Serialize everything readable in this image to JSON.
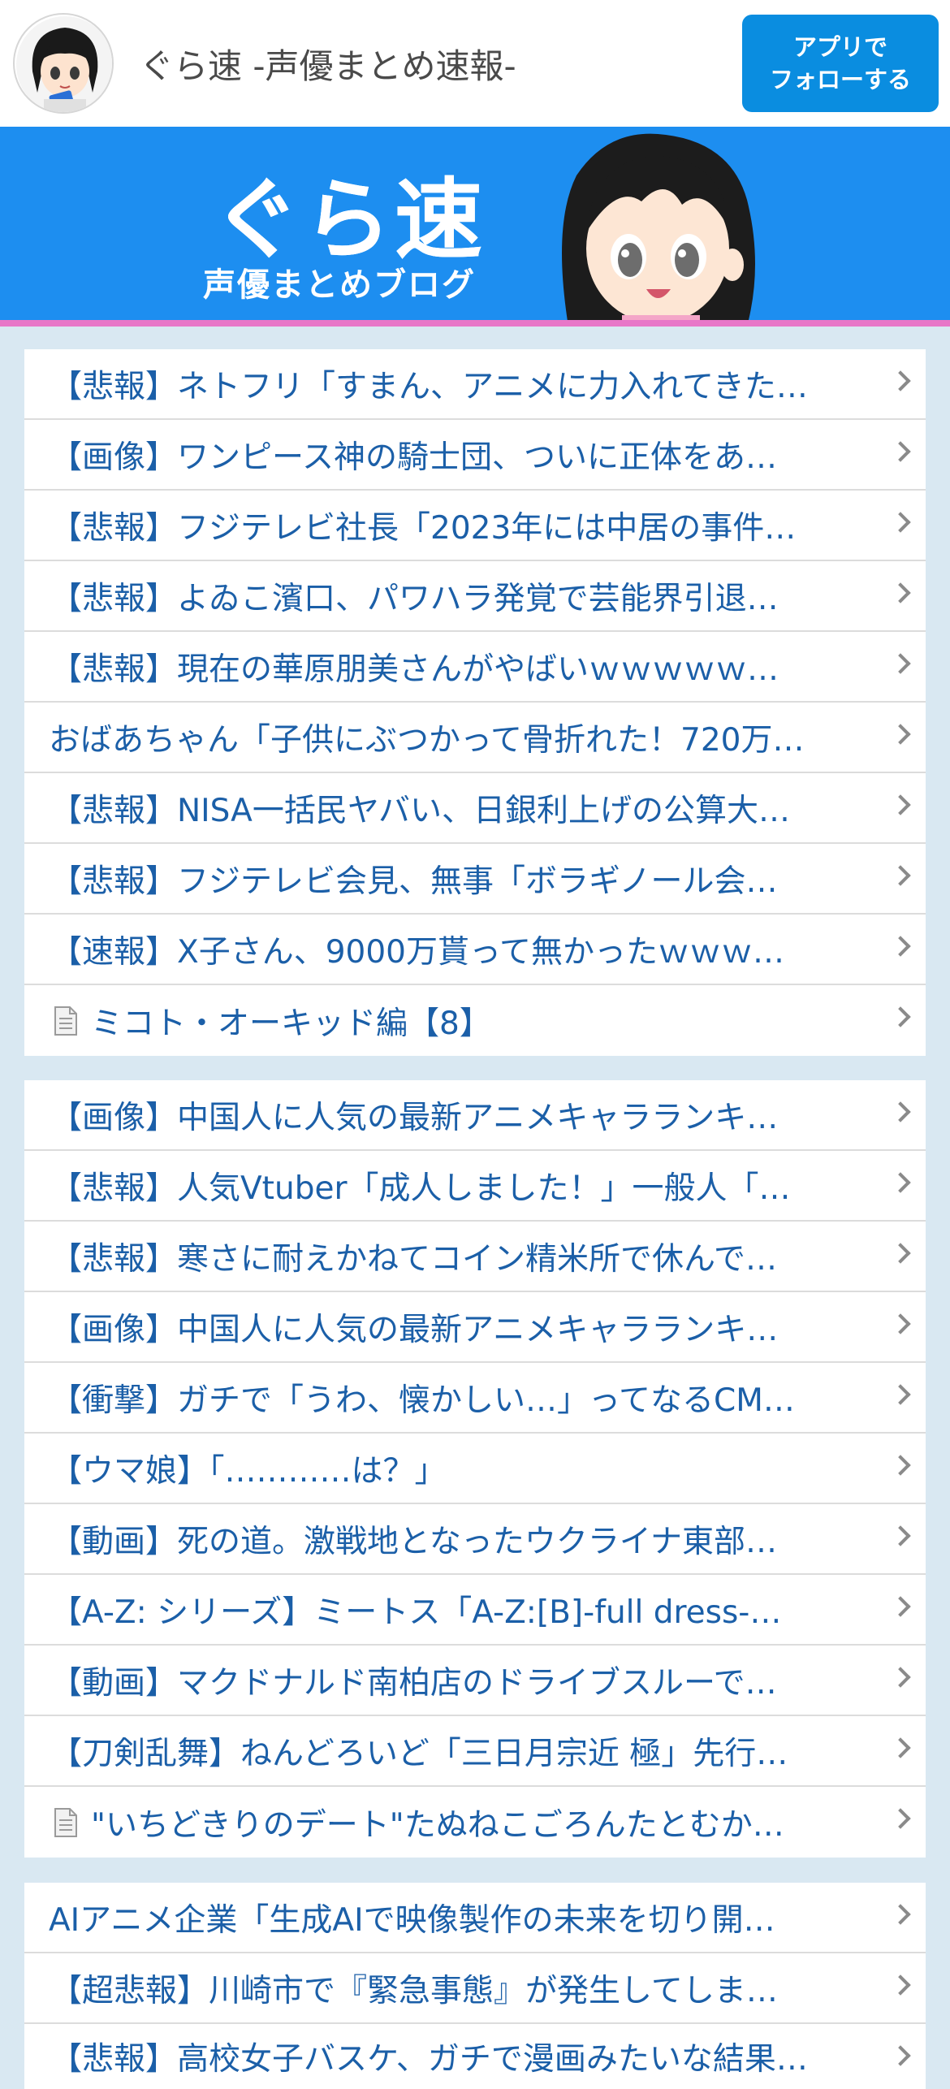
{
  "header": {
    "site_title": "ぐら速  -声優まとめ速報-",
    "follow_button_line1": "アプリで",
    "follow_button_line2": "フォローする"
  },
  "banner": {
    "logo_text": "ぐら速",
    "subtitle": "声優まとめブログ"
  },
  "lists": [
    {
      "items": [
        {
          "text": "【悲報】ネトフリ「すまん、アニメに力入れてきた…",
          "icon": null
        },
        {
          "text": "【画像】ワンピース神の騎士団、ついに正体をあ…",
          "icon": null
        },
        {
          "text": "【悲報】フジテレビ社長「2023年には中居の事件…",
          "icon": null
        },
        {
          "text": "【悲報】よゐこ濱口、パワハラ発覚で芸能界引退…",
          "icon": null
        },
        {
          "text": "【悲報】現在の華原朋美さんがやばいｗｗｗｗｗ…",
          "icon": null
        },
        {
          "text": "おばあちゃん「子供にぶつかって骨折れた！720万…",
          "icon": null
        },
        {
          "text": "【悲報】NISA一括民ヤバい、日銀利上げの公算大…",
          "icon": null
        },
        {
          "text": "【悲報】フジテレビ会見、無事「ボラギノール会…",
          "icon": null
        },
        {
          "text": "【速報】X子さん、9000万貰って無かったｗｗｗ…",
          "icon": null
        },
        {
          "text": "ミコト・オーキッド編【8】",
          "icon": "document-icon"
        }
      ]
    },
    {
      "items": [
        {
          "text": "【画像】中国人に人気の最新アニメキャラランキ…",
          "icon": null
        },
        {
          "text": "【悲報】人気Vtuber「成人しました！」一般人「…",
          "icon": null
        },
        {
          "text": "【悲報】寒さに耐えかねてコイン精米所で休んで…",
          "icon": null
        },
        {
          "text": "【画像】中国人に人気の最新アニメキャラランキ…",
          "icon": null
        },
        {
          "text": "【衝撃】ガチで「うわ、懐かしい…」ってなるCM…",
          "icon": null
        },
        {
          "text": "【ウマ娘】「…………は？」",
          "icon": null
        },
        {
          "text": "【動画】死の道。激戦地となったウクライナ東部…",
          "icon": null
        },
        {
          "text": "【A-Z: シリーズ】ミートス「A-Z:[B]-full dress-…",
          "icon": null
        },
        {
          "text": "【動画】マクドナルド南柏店のドライブスルーで…",
          "icon": null
        },
        {
          "text": "【刀剣乱舞】ねんどろいど「三日月宗近 極」先行…",
          "icon": null
        },
        {
          "text": "\"いちどきりのデート\"たぬねこごろんたとむか…",
          "icon": "document-icon"
        }
      ]
    },
    {
      "items": [
        {
          "text": "AIアニメ企業「生成AIで映像製作の未来を切り開…",
          "icon": null
        },
        {
          "text": "【超悲報】川崎市で『緊急事態』が発生してしま…",
          "icon": null
        },
        {
          "text": "【悲報】高校女子バスケ、ガチで漫画みたいな結果…",
          "icon": null
        }
      ]
    }
  ],
  "colors": {
    "link": "#1b5fa8",
    "banner_bg": "#1d8ef0",
    "banner_border": "#e877c8",
    "follow_button": "#0a8de0",
    "page_bg": "#d9e8f2"
  }
}
